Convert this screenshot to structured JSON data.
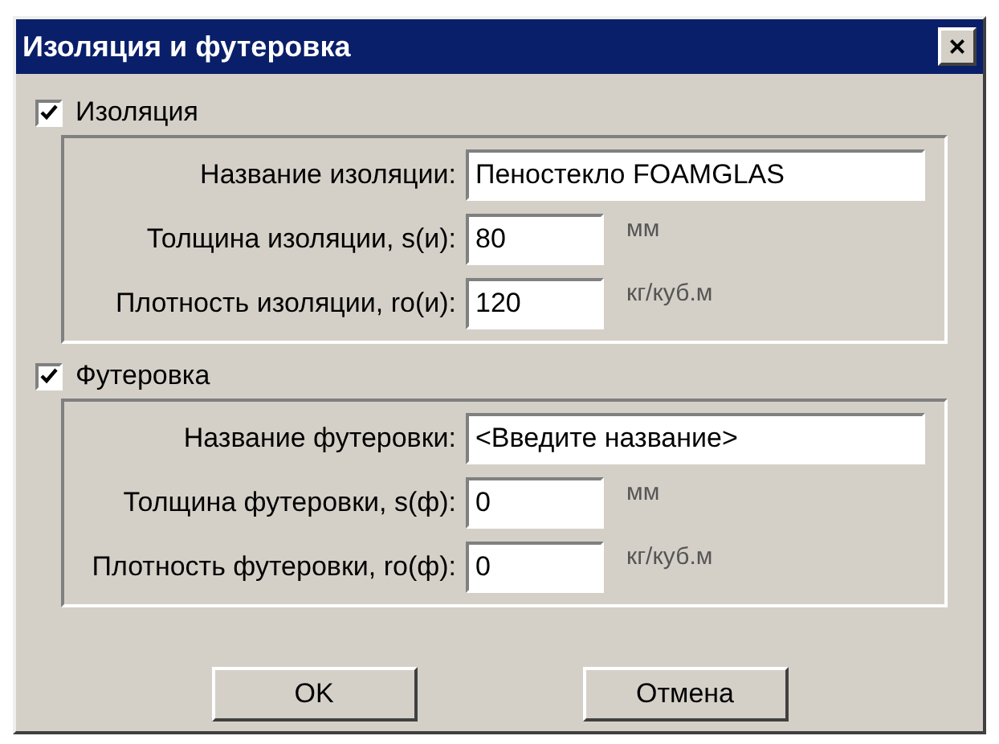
{
  "window": {
    "title": "Изоляция и футеровка",
    "close": "×"
  },
  "sections": [
    {
      "label": "Изоляция",
      "checked": true,
      "fields": [
        {
          "label": "Название изоляции:",
          "value": "Пеностекло FOAMGLAS",
          "kind": "wide"
        },
        {
          "label": "Толщина изоляции, s(и):",
          "value": "80",
          "unit": "мм",
          "kind": "number"
        },
        {
          "label": "Плотность изоляции, ro(и):",
          "value": "120",
          "unit": "кг/куб.м",
          "kind": "number"
        }
      ]
    },
    {
      "label": "Футеровка",
      "checked": true,
      "fields": [
        {
          "label": "Название футеровки:",
          "value": "<Введите название>",
          "kind": "wide"
        },
        {
          "label": "Толщина футеровки, s(ф):",
          "value": "0",
          "unit": "мм",
          "kind": "number"
        },
        {
          "label": "Плотность футеровки, ro(ф):",
          "value": "0",
          "unit": "кг/куб.м",
          "kind": "number"
        }
      ]
    }
  ],
  "buttons": [
    "OK",
    "Отмена"
  ]
}
